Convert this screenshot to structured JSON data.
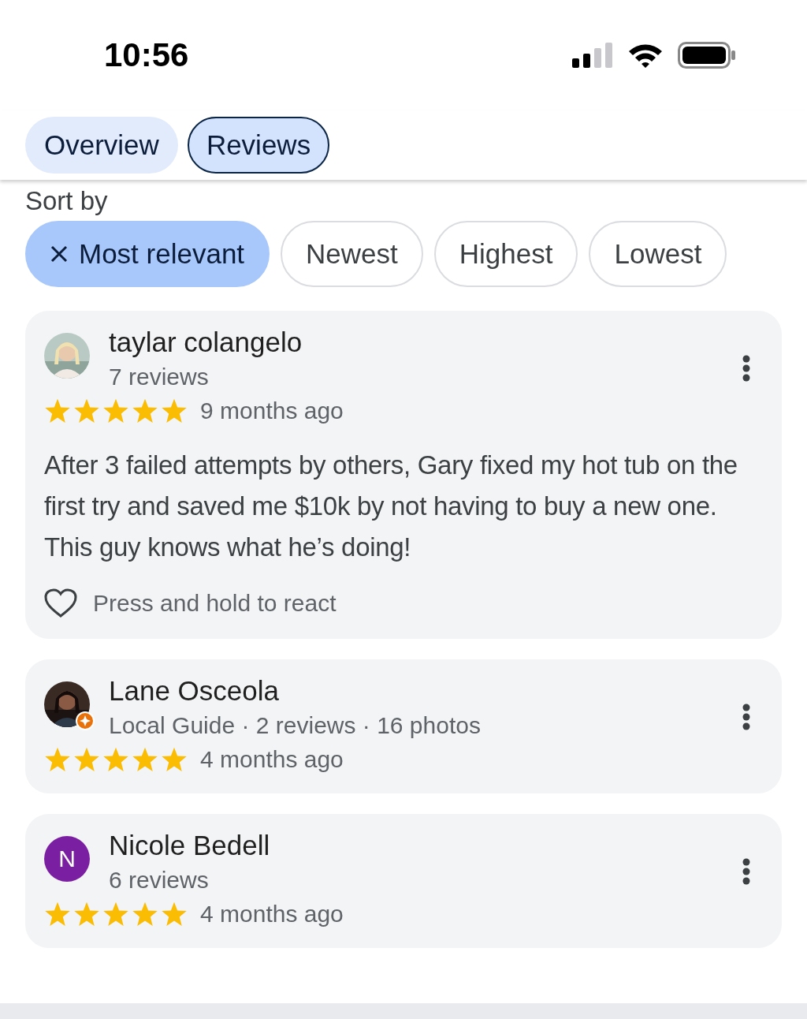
{
  "status_bar": {
    "time": "10:56"
  },
  "tabs": [
    {
      "label": "Overview",
      "selected": false
    },
    {
      "label": "Reviews",
      "selected": true
    }
  ],
  "sort": {
    "label": "Sort by",
    "options": [
      {
        "label": "Most relevant",
        "selected": true
      },
      {
        "label": "Newest",
        "selected": false
      },
      {
        "label": "Highest",
        "selected": false
      },
      {
        "label": "Lowest",
        "selected": false
      }
    ]
  },
  "reviews": [
    {
      "local_guide": false,
      "name": "taylar colangelo",
      "meta": "7 reviews",
      "stars": 5,
      "time": "9 months ago",
      "text": "After 3 failed attempts by others, Gary fixed my hot tub on the first try and saved me $10k by not having to buy a new one. This guy knows what he’s doing!",
      "react": "Press and hold to react"
    },
    {
      "local_guide": true,
      "name": "Lane Osceola",
      "meta": "Local Guide · 2 reviews · 16 photos",
      "stars": 5,
      "time": "4 months ago"
    },
    {
      "avatar": {
        "kind": "letter",
        "letter": "N",
        "color": "#7b1fa2"
      },
      "local_guide": false,
      "name": "Nicole Bedell",
      "meta": "6 reviews",
      "stars": 5,
      "time": "4 months ago"
    }
  ]
}
